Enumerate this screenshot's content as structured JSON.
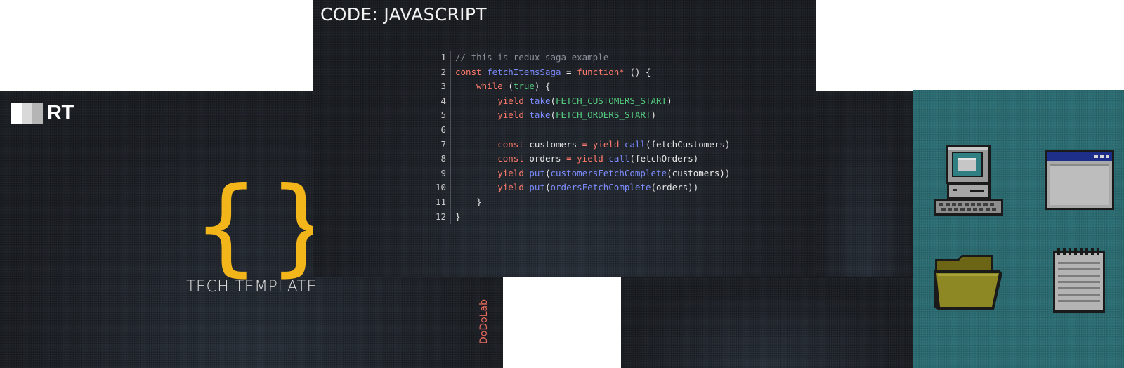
{
  "left_slide": {
    "logo_text": "RT",
    "title": "TECH TEMPLATE",
    "braces_glyph": "{}",
    "brace_color": "#f2b61b"
  },
  "code_slide": {
    "title": "CODE: JAVASCRIPT",
    "lines": [
      {
        "n": "1",
        "tokens": [
          {
            "t": "// this is redux saga example",
            "c": "comment"
          }
        ]
      },
      {
        "n": "2",
        "tokens": [
          {
            "t": "const ",
            "c": "keyword"
          },
          {
            "t": "fetchItemsSaga",
            "c": "func"
          },
          {
            "t": " = ",
            "c": "default"
          },
          {
            "t": "function*",
            "c": "keyword"
          },
          {
            "t": " () {",
            "c": "default"
          }
        ]
      },
      {
        "n": "3",
        "tokens": [
          {
            "t": "    ",
            "c": "default"
          },
          {
            "t": "while",
            "c": "keyword"
          },
          {
            "t": " (",
            "c": "default"
          },
          {
            "t": "true",
            "c": "const"
          },
          {
            "t": ") {",
            "c": "default"
          }
        ]
      },
      {
        "n": "4",
        "tokens": [
          {
            "t": "        ",
            "c": "default"
          },
          {
            "t": "yield",
            "c": "keyword"
          },
          {
            "t": " ",
            "c": "default"
          },
          {
            "t": "take",
            "c": "func"
          },
          {
            "t": "(",
            "c": "default"
          },
          {
            "t": "FETCH_CUSTOMERS_START",
            "c": "const"
          },
          {
            "t": ")",
            "c": "default"
          }
        ]
      },
      {
        "n": "5",
        "tokens": [
          {
            "t": "        ",
            "c": "default"
          },
          {
            "t": "yield",
            "c": "keyword"
          },
          {
            "t": " ",
            "c": "default"
          },
          {
            "t": "take",
            "c": "func"
          },
          {
            "t": "(",
            "c": "default"
          },
          {
            "t": "FETCH_ORDERS_START",
            "c": "const"
          },
          {
            "t": ")",
            "c": "default"
          }
        ]
      },
      {
        "n": "6",
        "tokens": []
      },
      {
        "n": "7",
        "tokens": [
          {
            "t": "        ",
            "c": "default"
          },
          {
            "t": "const",
            "c": "keyword"
          },
          {
            "t": " customers ",
            "c": "default"
          },
          {
            "t": "=",
            "c": "keyword"
          },
          {
            "t": " ",
            "c": "default"
          },
          {
            "t": "yield",
            "c": "keyword"
          },
          {
            "t": " ",
            "c": "default"
          },
          {
            "t": "call",
            "c": "func"
          },
          {
            "t": "(fetchCustomers)",
            "c": "default"
          }
        ]
      },
      {
        "n": "8",
        "tokens": [
          {
            "t": "        ",
            "c": "default"
          },
          {
            "t": "const",
            "c": "keyword"
          },
          {
            "t": " orders ",
            "c": "default"
          },
          {
            "t": "=",
            "c": "keyword"
          },
          {
            "t": " ",
            "c": "default"
          },
          {
            "t": "yield",
            "c": "keyword"
          },
          {
            "t": " ",
            "c": "default"
          },
          {
            "t": "call",
            "c": "func"
          },
          {
            "t": "(fetchOrders)",
            "c": "default"
          }
        ]
      },
      {
        "n": "9",
        "tokens": [
          {
            "t": "        ",
            "c": "default"
          },
          {
            "t": "yield",
            "c": "keyword"
          },
          {
            "t": " ",
            "c": "default"
          },
          {
            "t": "put",
            "c": "func"
          },
          {
            "t": "(",
            "c": "default"
          },
          {
            "t": "customersFetchComplete",
            "c": "func"
          },
          {
            "t": "(customers))",
            "c": "default"
          }
        ]
      },
      {
        "n": "10",
        "tokens": [
          {
            "t": "        ",
            "c": "default"
          },
          {
            "t": "yield",
            "c": "keyword"
          },
          {
            "t": " ",
            "c": "default"
          },
          {
            "t": "put",
            "c": "func"
          },
          {
            "t": "(",
            "c": "default"
          },
          {
            "t": "ordersFetchComplete",
            "c": "func"
          },
          {
            "t": "(orders))",
            "c": "default"
          }
        ]
      },
      {
        "n": "11",
        "tokens": [
          {
            "t": "    }",
            "c": "default"
          }
        ]
      },
      {
        "n": "12",
        "tokens": [
          {
            "t": "}",
            "c": "default"
          }
        ]
      }
    ]
  },
  "footer": {
    "brand_link": "DoDoLab"
  },
  "desktop": {
    "icons": [
      "computer-icon",
      "window-icon",
      "folder-icon",
      "notepad-icon"
    ]
  },
  "colors": {
    "dark_bg": "#1c1f24",
    "teal_bg": "#2b6d72",
    "accent_yellow": "#f2b61b",
    "link_red": "#e86a5e"
  }
}
